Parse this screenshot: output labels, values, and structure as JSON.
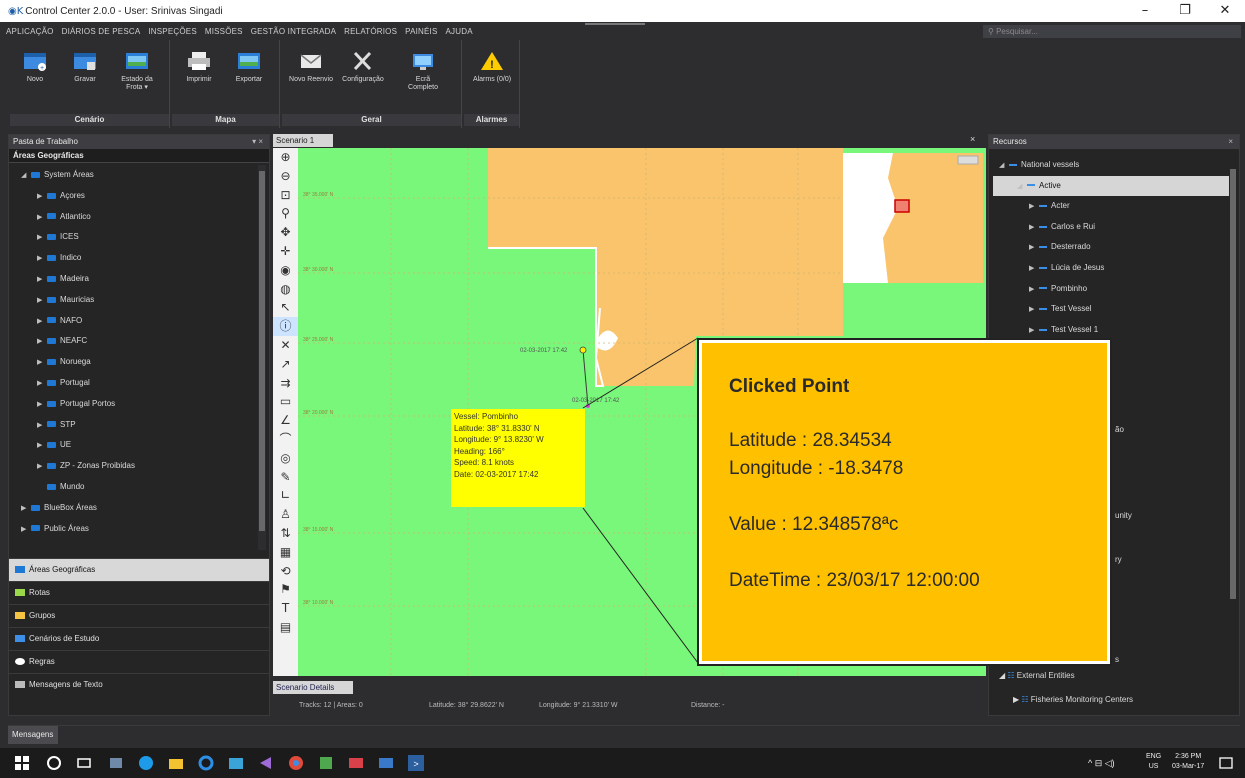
{
  "window": {
    "title": "Control Center 2.0.0 - User: Srinivas Singadi",
    "logo": "◉K"
  },
  "menu": [
    "APLICAÇÃO",
    "DIÁRIOS DE PESCA",
    "INSPEÇÕES",
    "MISSÕES",
    "GESTÃO INTEGRADA",
    "RELATÓRIOS",
    "PAINÉIS",
    "AJUDA"
  ],
  "search": {
    "placeholder": "Pesquisar..."
  },
  "ribbon": {
    "groups": [
      {
        "label": "Cenário",
        "buttons": [
          "Novo",
          "Gravar",
          "Estado da Frota ▾"
        ]
      },
      {
        "label": "Mapa",
        "buttons": [
          "Imprimir",
          "Exportar"
        ]
      },
      {
        "label": "Geral",
        "buttons": [
          "Novo Reenvio",
          "Configuração",
          "Ecrã Completo"
        ]
      },
      {
        "label": "Alarmes",
        "buttons": [
          "Alarms (0/0)"
        ]
      }
    ]
  },
  "left_panel": {
    "title": "Pasta de Trabalho",
    "header_tools": "▾ ×",
    "subheader": "Áreas Geográficas",
    "tree": [
      "System Áreas",
      "Açores",
      "Atlantico",
      "ICES",
      "Indico",
      "Madeira",
      "Mauricias",
      "NAFO",
      "NEAFC",
      "Noruega",
      "Portugal",
      "Portugal Portos",
      "STP",
      "UE",
      "ZP - Zonas Proibidas",
      "Mundo",
      "BlueBox Áreas",
      "Public Áreas"
    ],
    "tabs": [
      "Áreas Geográficas",
      "Rotas",
      "Grupos",
      "Cenários de Estudo",
      "Regras",
      "Mensagens de Texto"
    ]
  },
  "scenario": {
    "tab": "Scenario 1",
    "close": "×",
    "details_tab": "Scenario Details",
    "status": {
      "tracks": "Tracks: 12 | Areas: 0",
      "latitude": "Latitude: 38° 29.8622' N",
      "longitude": "Longitude: 9° 21.3310' W",
      "distance": "Distance: -"
    }
  },
  "map": {
    "vessel_label": "02-03-2017 17:42",
    "vessel_label2": "02-03-2017 17:42",
    "tooltip": {
      "vessel": "Vessel: Pombinho",
      "latitude": "Latitude: 38° 31.8330' N",
      "longitude": "Longitude: 9° 13.8230' W",
      "heading": "Heading: 166°",
      "speed": "Speed: 8.1 knots",
      "date": "Date: 02-03-2017 17:42"
    },
    "lat_labels": [
      "38° 35.000' N",
      "38° 30.000' N",
      "38° 25.000' N",
      "38° 20.000' N",
      "38° 15.000' N",
      "38° 10.000' N"
    ],
    "colors": {
      "sea": "#78f77a",
      "land": "#f9c46b",
      "coast": "#ffffff"
    }
  },
  "callout": {
    "title": "Clicked Point",
    "latitude": "Latitude : 28.34534",
    "longitude": "Longitude : -18.3478",
    "value": "Value : 12.348578ªc",
    "datetime": "DateTime : 23/03/17 12:00:00",
    "color": "#ffc000"
  },
  "right_panel": {
    "title": "Recursos",
    "close": "×",
    "tree": [
      {
        "label": "National vessels",
        "indent": 0
      },
      {
        "label": "Active",
        "indent": 1,
        "selected": true
      },
      {
        "label": "Acter",
        "indent": 2
      },
      {
        "label": "Carlos e Rui",
        "indent": 2
      },
      {
        "label": "Desterrado",
        "indent": 2
      },
      {
        "label": "Lúcia de Jesus",
        "indent": 2
      },
      {
        "label": "Pombinho",
        "indent": 2
      },
      {
        "label": "Test Vessel",
        "indent": 2
      },
      {
        "label": "Test Vessel 1",
        "indent": 2
      }
    ],
    "partial": [
      "ão",
      "unity",
      "ry",
      "s"
    ],
    "bottom": [
      "External Entities",
      "Fisheries Monitoring Centers"
    ]
  },
  "messages": {
    "label": "Mensagens"
  },
  "taskbar": {
    "lang": "ENG",
    "region": "US",
    "time": "2:36 PM",
    "date": "03-Mar-17"
  }
}
